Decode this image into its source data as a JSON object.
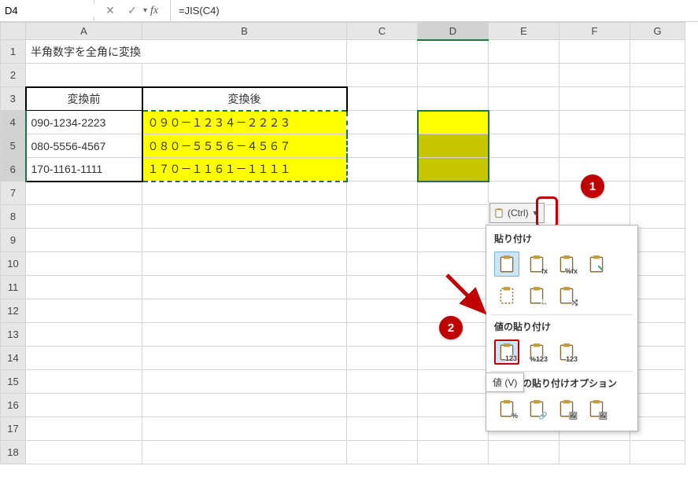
{
  "formula_bar": {
    "cell_ref": "D4",
    "formula": "=JIS(C4)"
  },
  "columns": [
    "A",
    "B",
    "C",
    "D",
    "E",
    "F",
    "G"
  ],
  "row_count": 18,
  "active_cell": "D4",
  "selection": "D4:D6",
  "copy_range": "B4:B6",
  "cells": {
    "A1": "半角数字を全角に変換",
    "A3": "変換前",
    "B3": "変換後",
    "A4": "090-1234-2223",
    "A5": "080-5556-4567",
    "A6": "170-1161-1111",
    "B4": "０９０－１２３４－２２２３",
    "B5": "０８０－５５５６－４５６７",
    "B6": "１７０－１１６１－１１１１"
  },
  "paste_button": {
    "label": "(Ctrl)"
  },
  "popup": {
    "section1_title": "貼り付け",
    "section2_title": "値の貼り付け",
    "section3_title": "その他の貼り付けオプション",
    "options1": [
      {
        "name": "paste",
        "sub": ""
      },
      {
        "name": "paste-formulas",
        "sub": "fx"
      },
      {
        "name": "paste-formulas-number-fmt",
        "sub": "%fx"
      },
      {
        "name": "paste-keep-source-fmt",
        "sub": ""
      }
    ],
    "options1b": [
      {
        "name": "paste-no-borders",
        "sub": ""
      },
      {
        "name": "paste-keep-col-width",
        "sub": "↔"
      },
      {
        "name": "paste-transpose",
        "sub": "⤭"
      }
    ],
    "options2": [
      {
        "name": "paste-values",
        "sub": "123"
      },
      {
        "name": "paste-values-number-fmt",
        "sub": "%123"
      },
      {
        "name": "paste-values-source-fmt",
        "sub": "123"
      }
    ],
    "options3": [
      {
        "name": "paste-formatting",
        "sub": "%"
      },
      {
        "name": "paste-link",
        "sub": "🔗"
      },
      {
        "name": "paste-picture",
        "sub": "🖼"
      },
      {
        "name": "paste-linked-picture",
        "sub": "🖼"
      }
    ]
  },
  "tooltip": "値 (V)",
  "annotations": {
    "badge1": "1",
    "badge2": "2"
  }
}
